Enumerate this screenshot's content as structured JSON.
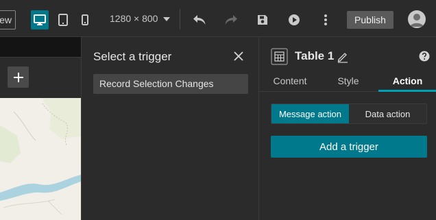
{
  "toolbar": {
    "preview_label": "ew",
    "resolution": "1280 × 800",
    "publish_label": "Publish"
  },
  "trigger_panel": {
    "title": "Select a trigger",
    "options": [
      {
        "label": "Record Selection Changes"
      }
    ]
  },
  "settings_panel": {
    "widget_title": "Table 1",
    "tabs": [
      {
        "label": "Content",
        "active": false
      },
      {
        "label": "Style",
        "active": false
      },
      {
        "label": "Action",
        "active": true
      }
    ],
    "action_types": [
      {
        "label": "Message action",
        "active": true
      },
      {
        "label": "Data action",
        "active": false
      }
    ],
    "add_trigger_label": "Add a trigger"
  },
  "colors": {
    "accent": "#00798c",
    "tab_underline": "#00a0b7",
    "panel_bg": "#2b2b2b",
    "canvas_bg": "#1e1e1e",
    "map_land": "#f1efe8",
    "map_water": "#aad3df"
  },
  "icons": {
    "desktop": "desktop-icon",
    "tablet": "tablet-icon",
    "phone": "phone-icon",
    "undo": "undo-icon",
    "redo": "redo-icon",
    "save": "save-icon",
    "play": "play-icon",
    "more": "more-vertical-icon",
    "user": "user-avatar-icon",
    "zoom_in": "plus-icon",
    "close": "close-icon",
    "table": "table-icon",
    "edit": "pencil-icon",
    "help": "help-icon"
  }
}
